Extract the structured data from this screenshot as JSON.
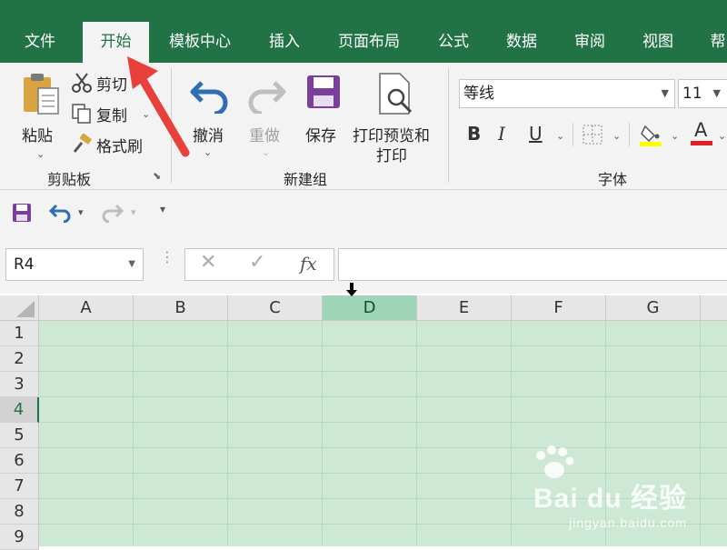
{
  "tabs": [
    {
      "label": "文件",
      "active": false
    },
    {
      "label": "开始",
      "active": true
    },
    {
      "label": "模板中心",
      "active": false
    },
    {
      "label": "插入",
      "active": false
    },
    {
      "label": "页面布局",
      "active": false
    },
    {
      "label": "公式",
      "active": false
    },
    {
      "label": "数据",
      "active": false
    },
    {
      "label": "审阅",
      "active": false
    },
    {
      "label": "视图",
      "active": false
    },
    {
      "label": "帮",
      "active": false
    }
  ],
  "clipboard": {
    "paste": "粘贴",
    "cut": "剪切",
    "copy": "复制",
    "format_painter": "格式刷",
    "group_label": "剪贴板"
  },
  "newgroup": {
    "undo": "撤消",
    "redo": "重做",
    "save": "保存",
    "print_preview": "打印预览和",
    "print_preview_2": "打印",
    "group_label": "新建组"
  },
  "font": {
    "font_name": "等线",
    "font_size": "11",
    "bold": "B",
    "italic": "I",
    "underline": "U",
    "font_color_label": "A",
    "group_label": "字体",
    "highlight_color": "#ffff00",
    "font_color": "#ff0000"
  },
  "formula_bar": {
    "name_box": "R4",
    "fx": "fx",
    "formula": ""
  },
  "grid": {
    "columns": [
      "A",
      "B",
      "C",
      "D",
      "E",
      "F",
      "G"
    ],
    "selected_column": "D",
    "rows": [
      "1",
      "2",
      "3",
      "4",
      "5",
      "6",
      "7",
      "8",
      "9"
    ],
    "active_row": "4"
  },
  "watermark": {
    "brand": "Bai du 经验",
    "url": "jingyan.baidu.com"
  },
  "colors": {
    "accent": "#217346",
    "arrow": "#e8413c",
    "selection_fill": "#cde8d4"
  }
}
